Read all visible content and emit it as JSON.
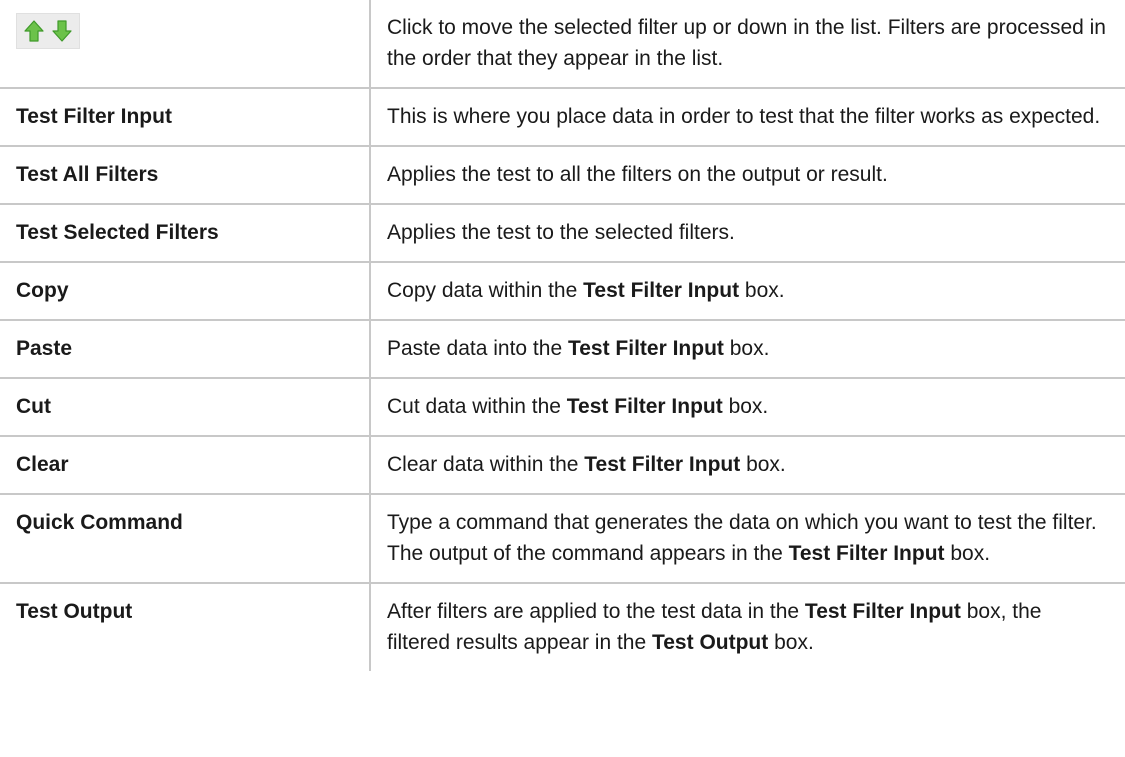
{
  "rows": [
    {
      "term": "",
      "icons": [
        "arrow-up-icon",
        "arrow-down-icon"
      ],
      "desc": [
        {
          "t": "Click to move the selected filter up or down in the list. Filters are processed in the order that they appear in the list.",
          "b": false
        }
      ]
    },
    {
      "term": "Test Filter Input",
      "desc": [
        {
          "t": "This is where you place data in order to test that the filter works as expected.",
          "b": false
        }
      ]
    },
    {
      "term": "Test All Filters",
      "desc": [
        {
          "t": "Applies the test to all the filters on the output or result.",
          "b": false
        }
      ]
    },
    {
      "term": "Test Selected Filters",
      "desc": [
        {
          "t": "Applies the test to the selected filters.",
          "b": false
        }
      ]
    },
    {
      "term": "Copy",
      "desc": [
        {
          "t": "Copy data within the ",
          "b": false
        },
        {
          "t": "Test Filter Input",
          "b": true
        },
        {
          "t": " box.",
          "b": false
        }
      ]
    },
    {
      "term": "Paste",
      "desc": [
        {
          "t": "Paste data into the ",
          "b": false
        },
        {
          "t": "Test Filter Input",
          "b": true
        },
        {
          "t": " box.",
          "b": false
        }
      ]
    },
    {
      "term": "Cut",
      "desc": [
        {
          "t": "Cut data within the ",
          "b": false
        },
        {
          "t": "Test Filter Input",
          "b": true
        },
        {
          "t": " box.",
          "b": false
        }
      ]
    },
    {
      "term": "Clear",
      "desc": [
        {
          "t": "Clear data within the ",
          "b": false
        },
        {
          "t": "Test Filter Input",
          "b": true
        },
        {
          "t": " box.",
          "b": false
        }
      ]
    },
    {
      "term": "Quick Command",
      "desc": [
        {
          "t": "Type a command that generates the data on which you want to test the filter. The output of the command appears in the ",
          "b": false
        },
        {
          "t": "Test Filter Input",
          "b": true
        },
        {
          "t": " box.",
          "b": false
        }
      ]
    },
    {
      "term": "Test Output",
      "desc": [
        {
          "t": "After filters are applied to the test data in the ",
          "b": false
        },
        {
          "t": "Test Filter Input",
          "b": true
        },
        {
          "t": " box, the filtered results appear in the ",
          "b": false
        },
        {
          "t": "Test Output",
          "b": true
        },
        {
          "t": " box.",
          "b": false
        }
      ]
    }
  ],
  "colors": {
    "border": "#c8c8c8",
    "arrow_fill": "#6cc24a",
    "arrow_stroke": "#3f9a2a",
    "icon_bg": "#ececec"
  }
}
